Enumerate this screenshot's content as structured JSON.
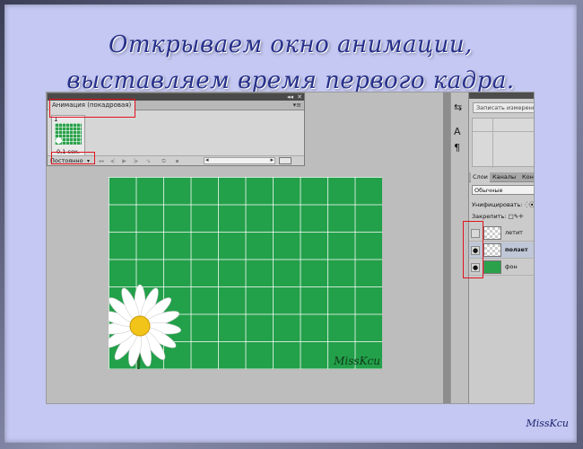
{
  "slide": {
    "title_line_1": "Открываем окно анимации,",
    "title_line_2": "выставляем время первого кадра.",
    "signature": "MissKcu"
  },
  "animation_panel": {
    "tab_label": "Анимация (покадровая)",
    "frame_number": "1",
    "frame_delay": "0,1 сек.",
    "loop_option": "Постоянно",
    "menu_icon": "panel-menu-icon",
    "controls": [
      "first-frame-icon",
      "prev-frame-icon",
      "play-icon",
      "next-frame-icon",
      "tween-icon",
      "duplicate-frame-icon",
      "delete-frame-icon"
    ]
  },
  "canvas": {
    "signature": "MissKcu",
    "background_color": "#23a04a"
  },
  "measurement_panel": {
    "button_label": "Записать измерения"
  },
  "layers_panel": {
    "tabs": [
      "Слои",
      "Каналы",
      "Конт"
    ],
    "blend_mode": "Обычные",
    "unify_label": "Унифицировать:",
    "lock_label": "Закрепить:",
    "layers": [
      {
        "name": "летит",
        "visible": false,
        "selected": false,
        "thumb": "checker"
      },
      {
        "name": "ползет",
        "visible": true,
        "selected": true,
        "thumb": "checker"
      },
      {
        "name": "фон",
        "visible": true,
        "selected": false,
        "thumb": "green"
      }
    ]
  },
  "colors": {
    "highlight": "#e0141e",
    "title": "#27308a",
    "slide_background": "#c4c8f2"
  }
}
